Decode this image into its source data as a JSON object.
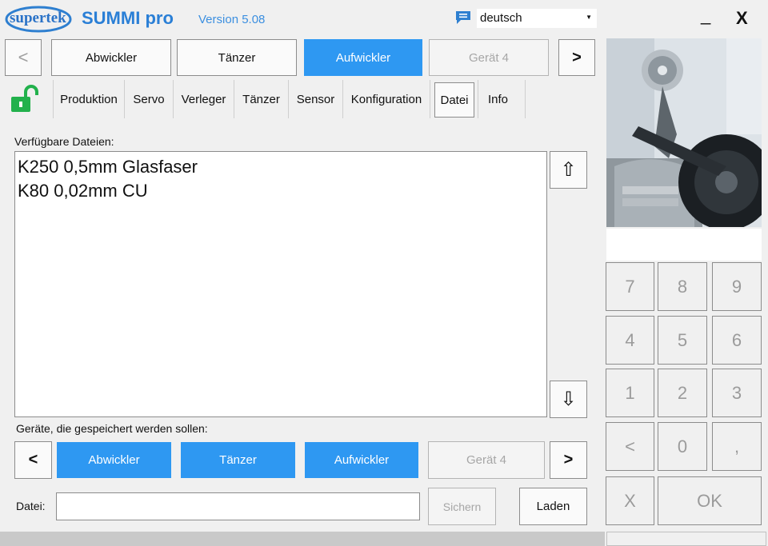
{
  "header": {
    "logo_text": "supertek",
    "app_title": "SUMMI pro",
    "version": "Version 5.08",
    "language": "deutsch",
    "minimize": "_",
    "close": "X"
  },
  "device_nav": {
    "prev": "<",
    "next": ">",
    "devices": [
      "Abwickler",
      "Tänzer",
      "Aufwickler",
      "Gerät 4"
    ],
    "active": "Aufwickler"
  },
  "tabs": [
    "Produktion",
    "Servo",
    "Verleger",
    "Tänzer",
    "Sensor",
    "Konfiguration",
    "Datei",
    "Info"
  ],
  "active_tab": "Datei",
  "files": {
    "label": "Verfügbare Dateien:",
    "items": [
      "K250 0,5mm Glasfaser",
      "K80 0,02mm CU"
    ],
    "scroll_up": "⇧",
    "scroll_down": "⇩"
  },
  "save_devices": {
    "label": "Geräte, die gespeichert werden sollen:",
    "prev": "<",
    "next": ">",
    "devices": [
      "Abwickler",
      "Tänzer",
      "Aufwickler",
      "Gerät 4"
    ]
  },
  "file_row": {
    "label": "Datei:",
    "value": "",
    "save": "Sichern",
    "load": "Laden"
  },
  "keypad": {
    "keys": [
      "7",
      "8",
      "9",
      "4",
      "5",
      "6",
      "1",
      "2",
      "3",
      "<",
      "0",
      ","
    ],
    "cancel": "X",
    "ok": "OK"
  },
  "colors": {
    "accent": "#2e98f2",
    "background": "#f0f0f0",
    "lock": "#22b14c"
  }
}
